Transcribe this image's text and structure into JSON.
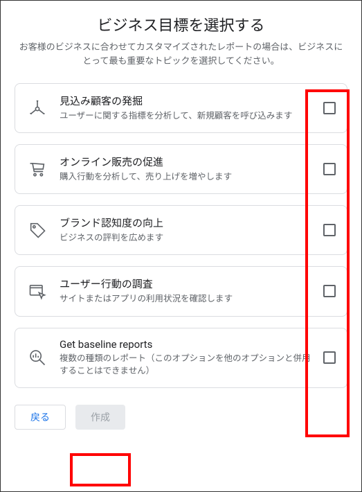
{
  "header": {
    "title": "ビジネス目標を選択する",
    "subtitle": "お客様のビジネスに合わせてカスタマイズされたレポートの場合は、ビジネスにとって最も重要なトピックを選択してください。"
  },
  "options": [
    {
      "title": "見込み顧客の発掘",
      "desc": "ユーザーに関する指標を分析して、新規顧客を呼び込みます"
    },
    {
      "title": "オンライン販売の促進",
      "desc": "購入行動を分析して、売り上げを増やします"
    },
    {
      "title": "ブランド認知度の向上",
      "desc": "ビジネスの評判を広めます"
    },
    {
      "title": "ユーザー行動の調査",
      "desc": "サイトまたはアプリの利用状況を確認します"
    },
    {
      "title": "Get baseline reports",
      "desc": "複数の種類のレポート（このオプションを他のオプションと併用することはできません）"
    }
  ],
  "footer": {
    "back": "戻る",
    "create": "作成"
  }
}
